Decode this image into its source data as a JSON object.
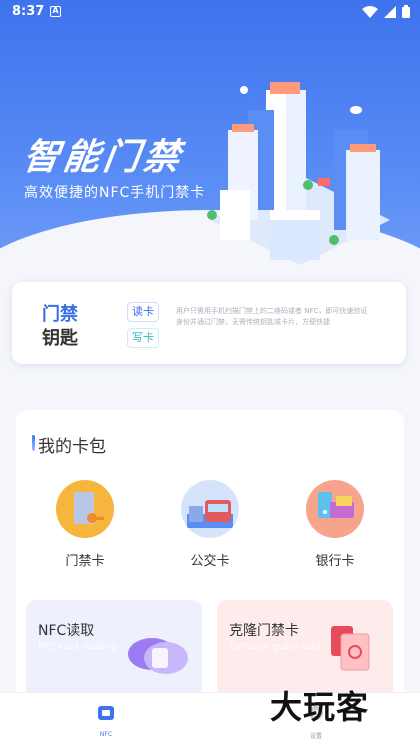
{
  "status_bar": {
    "time": "8:37",
    "notification_glyph": "A"
  },
  "hero": {
    "title": "智能门禁",
    "subtitle": "高效便捷的NFC手机门禁卡"
  },
  "key_card": {
    "title_line1": "门禁",
    "title_line2": "钥匙",
    "read_tag": "读卡",
    "write_tag": "写卡",
    "description": "用户只需用手机扫描门禁上的二维码或者 NFC，即可快速验证身份并通过门禁，无需传统钥匙或卡片，方便快捷"
  },
  "wallet": {
    "title": "我的卡包",
    "cards": [
      {
        "label": "门禁卡",
        "icon": "access-card-icon"
      },
      {
        "label": "公交卡",
        "icon": "bus-card-icon"
      },
      {
        "label": "银行卡",
        "icon": "bank-card-icon"
      }
    ]
  },
  "features": {
    "nfc": {
      "title": "NFC读取",
      "subtitle": "NFC card reading"
    },
    "clone": {
      "title": "克隆门禁卡",
      "subtitle": "Entrance guard card"
    }
  },
  "tabbar": {
    "tabs": [
      {
        "label": "NFC",
        "active": true
      },
      {
        "label": "设置",
        "active": false
      }
    ]
  },
  "watermark": "大玩客",
  "colors": {
    "primary": "#3f73ee",
    "accent_teal": "#36b6c9",
    "background": "#f4f6fb"
  }
}
